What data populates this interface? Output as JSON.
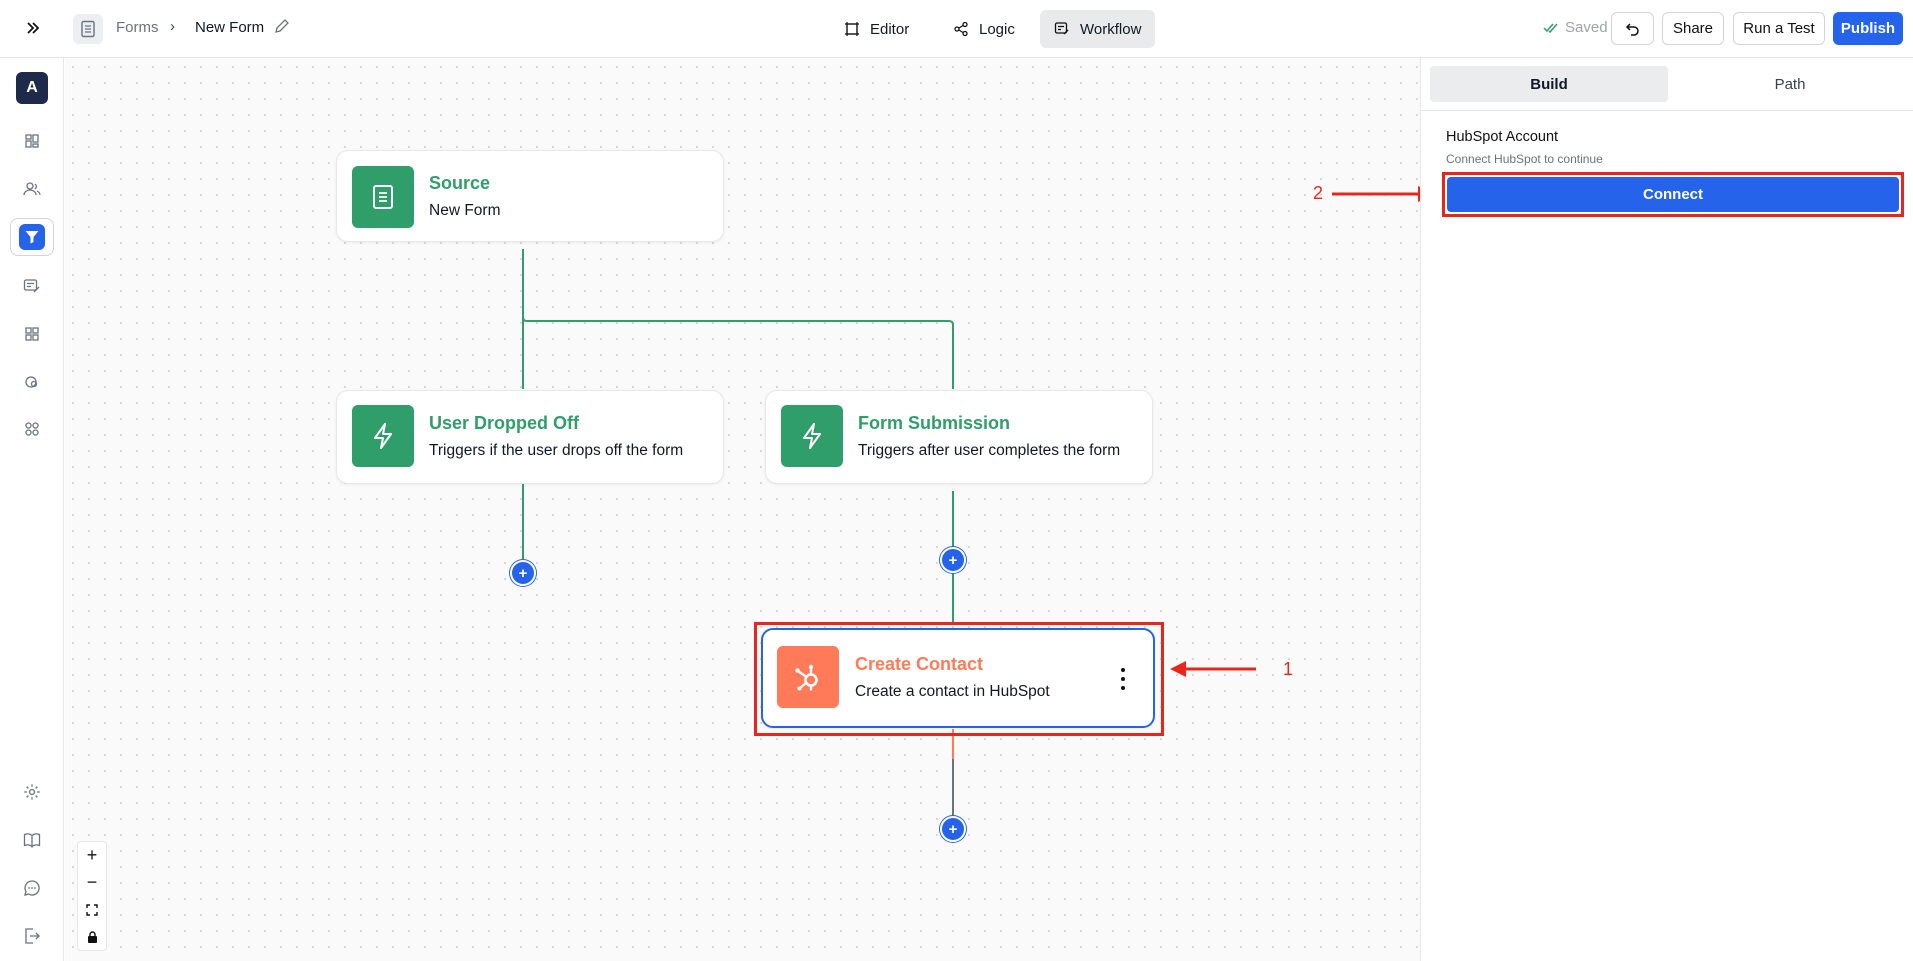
{
  "topbar": {
    "breadcrumb_root": "Forms",
    "breadcrumb_current": "New Form",
    "tabs": [
      {
        "label": "Editor",
        "icon": "frame-icon"
      },
      {
        "label": "Logic",
        "icon": "logic-icon"
      },
      {
        "label": "Workflow",
        "icon": "workflow-icon",
        "active": true
      }
    ],
    "saved_label": "Saved",
    "share_label": "Share",
    "test_label": "Run a Test",
    "publish_label": "Publish"
  },
  "leftrail": {
    "workspace_initial": "A",
    "items": [
      "dashboard-icon",
      "contacts-icon",
      "filter-icon",
      "workflow-icon",
      "apps-grid-icon",
      "integrations-icon",
      "templates-icon"
    ],
    "bottom_items": [
      "settings-icon",
      "docs-book-icon",
      "chat-icon",
      "logout-icon"
    ]
  },
  "canvas": {
    "nodes": {
      "source": {
        "title": "Source",
        "subtitle": "New Form"
      },
      "dropoff": {
        "title": "User Dropped Off",
        "subtitle": "Triggers if the user drops off the form"
      },
      "submission": {
        "title": "Form Submission",
        "subtitle": "Triggers after user completes the form"
      },
      "hubspot": {
        "title": "Create Contact",
        "subtitle": "Create a contact in HubSpot"
      }
    },
    "plus_label": "+",
    "zoom_controls": [
      "+",
      "−",
      "⛶",
      "🔒"
    ],
    "annotation_1": "1"
  },
  "panel": {
    "tabs": [
      "Build",
      "Path"
    ],
    "account_title": "HubSpot Account",
    "account_subtitle": "Connect HubSpot to continue",
    "connect_label": "Connect",
    "annotation_2": "2"
  },
  "colors": {
    "accent": "#2563eb",
    "green": "#2f9e6a",
    "hubspot": "#ff7a59",
    "annotation": "#e6281c"
  }
}
